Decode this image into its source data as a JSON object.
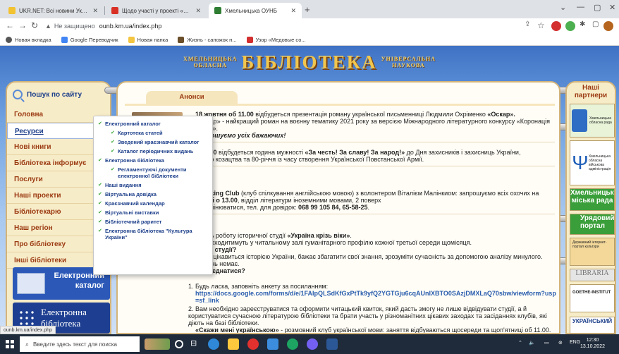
{
  "browser": {
    "tabs": [
      {
        "title": "UKR.NET: Всі новини України, о",
        "active": false,
        "favicon_color": "#f2c230"
      },
      {
        "title": "Щодо участі у проекті «Розвит",
        "active": false,
        "favicon_color": "#d93025"
      },
      {
        "title": "Хмельницька ОУНБ",
        "active": true,
        "favicon_color": "#2e7d32"
      }
    ],
    "new_tab": "+",
    "window_controls": [
      "⌄",
      "—",
      "▢",
      "✕"
    ],
    "address": {
      "security_label": "Не защищено",
      "url": "ounb.km.ua/index.php"
    },
    "bookmarks": [
      {
        "label": "Новая вкладка",
        "color": "#555555"
      },
      {
        "label": "Google Переводчик",
        "color": "#4285f4"
      },
      {
        "label": "Новая папка",
        "color": "#f3c541"
      },
      {
        "label": "Жизнь - сапожок н...",
        "color": "#6b4f2a"
      },
      {
        "label": "Узор «Медовые со...",
        "color": "#d32f2f"
      }
    ]
  },
  "banner": {
    "left_top": "ХМЕЛЬНИЦЬКА",
    "left_bottom": "ОБЛАСНА",
    "main": "БІБЛІОТЕКА",
    "right_top": "УНІВЕРСАЛЬНА",
    "right_bottom": "НАУКОВА"
  },
  "sidebar": {
    "search_label": "Пошук по сайту",
    "items": [
      {
        "label": "Головна"
      },
      {
        "label": "Ресурси"
      },
      {
        "label": "Нові книги"
      },
      {
        "label": "Бібліотека інформує"
      },
      {
        "label": "Послуги"
      },
      {
        "label": "Наші проекти"
      },
      {
        "label": "Бібліотекарю"
      },
      {
        "label": "Наш регіон"
      },
      {
        "label": "Про бібліотеку"
      },
      {
        "label": "Інші бібліотеки"
      }
    ],
    "promo1": {
      "line1": "Електронний",
      "line2": "каталог"
    },
    "promo2": {
      "line1": "Електронна",
      "line2": "бібліотека"
    }
  },
  "dropdown": {
    "items": [
      {
        "label": "Електронний каталог",
        "sub": false
      },
      {
        "label": "Картотека статей",
        "sub": true
      },
      {
        "label": "Зведений краєзнавчий каталог",
        "sub": true
      },
      {
        "label": "Каталог періодичних видань",
        "sub": true
      },
      {
        "label": "Електронна бібліотека",
        "sub": false
      },
      {
        "label": "Регламентуючі документи електронної бібліотеки",
        "sub": true
      },
      {
        "label": "Наші видання",
        "sub": false
      },
      {
        "label": "Віртуальна довідка",
        "sub": false
      },
      {
        "label": "Краєзнавчий календар",
        "sub": false
      },
      {
        "label": "Віртуальні виставки",
        "sub": false
      },
      {
        "label": "Бібліотечний раритет",
        "sub": false
      },
      {
        "label": "Електронна бібліотека \"Культура України\"",
        "sub": false
      }
    ]
  },
  "content": {
    "tab_label": "Анонси",
    "n1_date": "18 жовтня об 11.00",
    "n1_text": " відбудеться презентація роману української письменниці Людмили Охріменко ",
    "n1_title": "«Оскар».",
    "n1_line2": "«Оскар» - найкращий роман на воєнну тематику 2021 року за версією Міжнародного літературного конкурсу «Коронація",
    "n1_line3": "слова».",
    "n1_invite": "Запрошуємо усіх бажаючих!",
    "n2_date": "о 14.00",
    "n2_text": " відбудеться година мужності ",
    "n2_title": "«За честь! За славу! За народ!»",
    "n2_rest": " до Дня захисників і захисниць України,",
    "n2_line2": "ського козацтва та 80-річчя із часу створення Української Повстанської Армії.",
    "n3_title": "Speaking Club",
    "n3_text": " (клуб спілкування англійською мовою) з волонтером Віталієм Малінкиом: запрошуємо всіх охочих на",
    "n3_line2a": "неділі о 13.00",
    "n3_line2b": ", відділ літератури іноземними мовами, 2 поверх",
    "n3_line3a": "уть змінюватися, тел. для довідок: ",
    "n3_phone": "068 99 105 84, 65-58-25",
    "n3_dot": ".",
    "n4_line1a": "жають роботу історичної студії ",
    "n4_title": "«Україна крізь віки»",
    "n4_line1b": ".",
    "n4_line2": "ня проходитимуть у читальному залі гуманітарного профілю кожної третьої середи щомісяця.",
    "n4_q1": "ого ці студії?",
    "n4_a1": "х, хто цікавиться історією України, бажає збагатити свої знання, зрозуміти сучасність за допомогою аналізу минулого.",
    "n4_a2": "межень немає.",
    "n4_q2": "е приєднатися?",
    "n4_s1": "1. Будь ласка, заповніть анкету за посиланням:",
    "n4_link": "https://docs.google.com/forms/d/e/1FAIpQLSdKfGxPtTk9yfQ2YGTGju6cqAUnIXBTO0SAzjDMXLaQ70sbw/viewform?usp=sf_link",
    "n4_s2": "2. Вам необхідно зареєструватися та оформити читацький квиток, який дасть змогу не лише відвідувати студії, а й користуватися сучасною літературою бібліотеки та брати участь у різноманітних цікавих заходах та засіданнях клубів, які діють на базі бібліотеки.",
    "n5_title": "«Скажи мені українською»",
    "n5_text": " - розмовний клуб української мови: заняття відбуваються щосереди та щоп'ятниці об 11.00."
  },
  "partners": {
    "title_line1": "Наші",
    "title_line2": "партнери",
    "boxes": [
      {
        "label": "",
        "text": "Хмельницька обласна рада",
        "color": "#e8f3d8"
      },
      {
        "label": "",
        "text": "Хмельницька обласна військова адміністрація",
        "color": "#ffffff"
      },
      {
        "label": "Хмельницька міська рада",
        "text": "",
        "color": "#3a9f3a"
      },
      {
        "label": "Урядовий портал",
        "text": "",
        "color": "#3a9f3a"
      },
      {
        "label": "",
        "text": "Державний інтернет-портал культури",
        "color": "#f3d89a"
      },
      {
        "label": "LIBRARIA",
        "text": "",
        "color": "#e5e5e5"
      },
      {
        "label": "",
        "text": "GOETHE-INSTITUT",
        "color": "#ffffff"
      },
      {
        "label": "УКРАЇНСЬКИЙ",
        "text": "",
        "color": "#ffffff"
      }
    ]
  },
  "status_url": "ounb.km.ua/index.php",
  "taskbar": {
    "search_placeholder": "Введите здесь текст для поиска",
    "lang": "ENG",
    "time": "12:30",
    "date": "13.10.2022"
  }
}
